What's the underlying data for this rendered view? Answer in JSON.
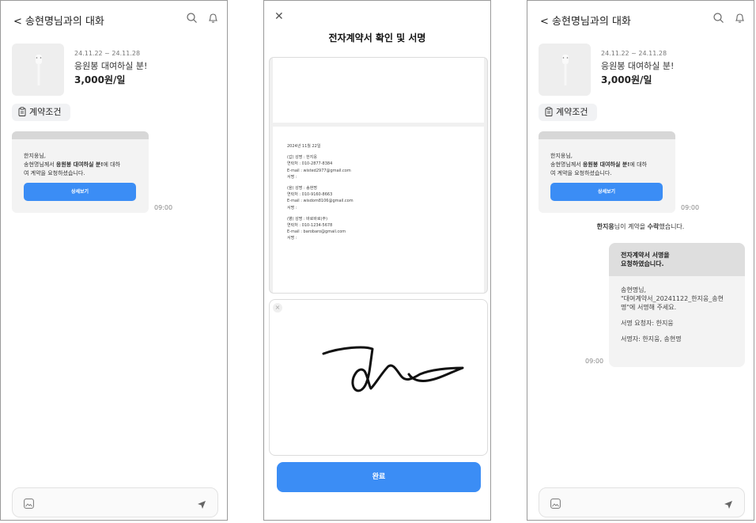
{
  "chat": {
    "title": "송현명님과의 대화",
    "product": {
      "dates": "24.11.22 ~ 24.11.28",
      "name": "응원봉 대여하실 분!",
      "price": "3,000원/일"
    },
    "terms_chip": "계약조건",
    "request_card": {
      "line1": "한지웅님,",
      "line2_pre": "송현명님께서 ",
      "line2_bold": "응원봉 대여하실 분!",
      "line2_post": "에 대하",
      "line3": "여 계약을 요청하셨습니다.",
      "button": "상세보기"
    },
    "time": "09:00"
  },
  "contract": {
    "title": "전자계약서 확인 및 서명",
    "date": "2024년 11월 22일",
    "parties": [
      {
        "name_line": "(갑) 성명   : 한지웅",
        "phone_line": "연락처   : 010-2877-8384",
        "email_line": "E-mail   : wisted2977@gmail.com",
        "sign_line": "서명   :"
      },
      {
        "name_line": "(을) 성명   : 송현명",
        "phone_line": "연락처   : 010-9160-8663",
        "email_line": "E-mail   : wisdom8106@gmail.com",
        "sign_line": "서명   :"
      },
      {
        "name_line": "(병) 성명   : 바로바로(주)",
        "phone_line": "연락처   : 010-1234-5678",
        "email_line": "E-mail   : barobaro@gmail.com",
        "sign_line": "서명   :"
      }
    ],
    "clear": "×",
    "done_button": "완료"
  },
  "chat_after": {
    "system_name": "한지웅",
    "system_mid": "님이 계약을 ",
    "system_bold": "수락",
    "system_post": "했습니다.",
    "sign_request": {
      "head1": "전자계약서 서명을",
      "head2": "요청하였습니다.",
      "greet": "송현명님,",
      "doc1": "\"대여계약서_20241122_한지웅_송현",
      "doc2": "명\"에 서명해 주세요.",
      "requester": "서명 요청자: 한지웅",
      "signers": "서명자: 한지웅, 송현명"
    },
    "time": "09:00"
  },
  "icons": [
    "back-icon",
    "search-icon",
    "bell-icon",
    "clipboard-icon",
    "image-icon",
    "send-icon",
    "close-icon"
  ]
}
